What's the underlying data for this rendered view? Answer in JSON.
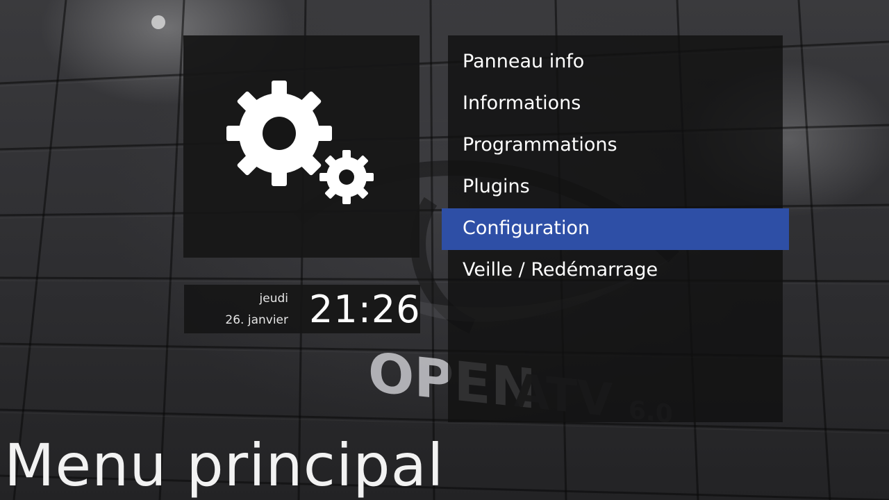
{
  "screen": {
    "title": "Menu principal"
  },
  "clock": {
    "weekday": "jeudi",
    "date": "26. janvier",
    "time": "21:26"
  },
  "icon_panel": {
    "icon": "gears-icon"
  },
  "menu": {
    "selected_index": 4,
    "highlight_color": "#2e4fa6",
    "items": [
      {
        "label": "Panneau info"
      },
      {
        "label": "Informations"
      },
      {
        "label": "Programmations"
      },
      {
        "label": "Plugins"
      },
      {
        "label": "Configuration"
      },
      {
        "label": "Veille / Redémarrage"
      }
    ]
  },
  "background": {
    "watermark_logo": "OPEN ATV 6.0"
  }
}
